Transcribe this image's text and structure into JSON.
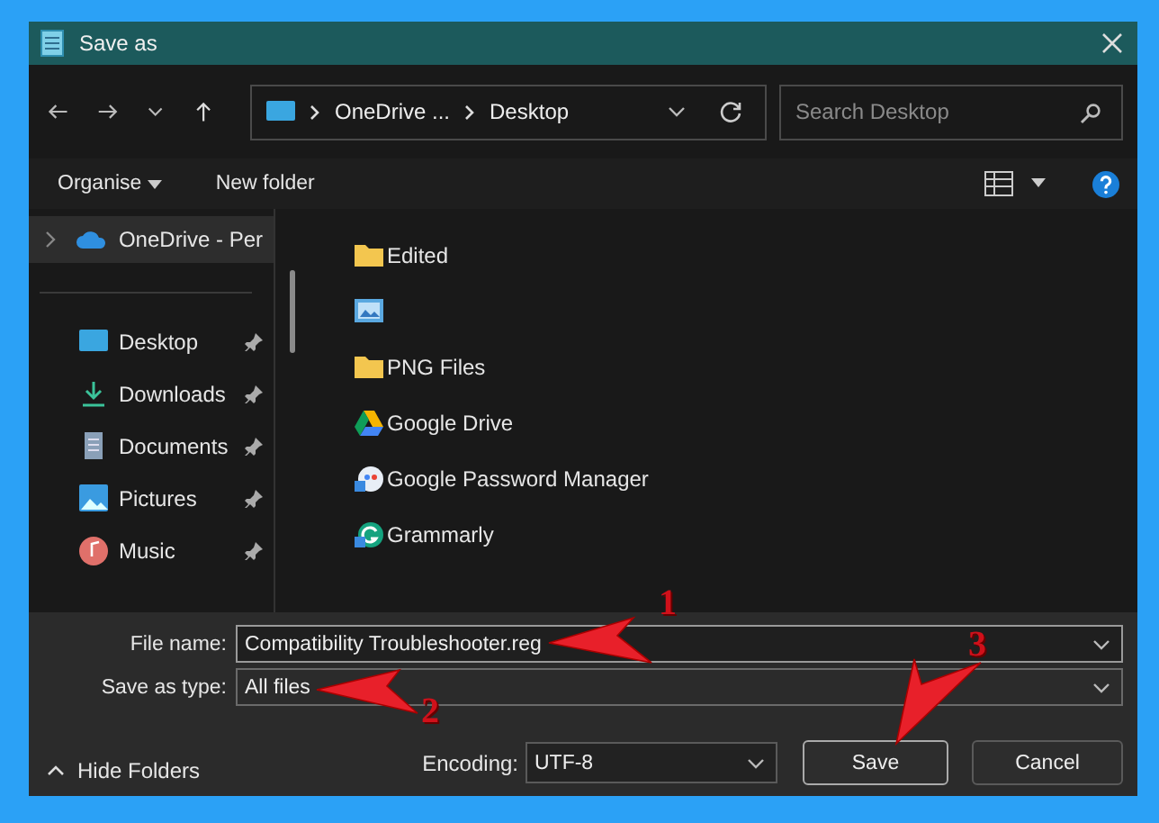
{
  "window": {
    "title": "Save as"
  },
  "address_bar": {
    "segments": [
      "OneDrive ...",
      "Desktop"
    ]
  },
  "search": {
    "placeholder": "Search Desktop"
  },
  "toolbar": {
    "organise": "Organise",
    "new_folder": "New folder"
  },
  "sidebar": {
    "items": [
      {
        "label": "OneDrive - Per",
        "kind": "cloud",
        "selected": true,
        "pinned": false
      },
      {
        "label": "Desktop",
        "kind": "desktop",
        "selected": false,
        "pinned": true
      },
      {
        "label": "Downloads",
        "kind": "download",
        "selected": false,
        "pinned": true
      },
      {
        "label": "Documents",
        "kind": "document",
        "selected": false,
        "pinned": true
      },
      {
        "label": "Pictures",
        "kind": "picture",
        "selected": false,
        "pinned": true
      },
      {
        "label": "Music",
        "kind": "music",
        "selected": false,
        "pinned": true
      }
    ]
  },
  "files": [
    {
      "name": "Edited",
      "kind": "folder"
    },
    {
      "kind": "image"
    },
    {
      "name": "PNG Files",
      "kind": "folder"
    },
    {
      "name": "Google Drive",
      "kind": "drive"
    },
    {
      "name": "Google Password Manager",
      "kind": "password"
    },
    {
      "name": "Grammarly",
      "kind": "grammarly"
    }
  ],
  "form": {
    "file_name_label": "File name:",
    "file_name": "Compatibility Troubleshooter.reg",
    "type_label": "Save as type:",
    "type": "All files",
    "encoding_label": "Encoding:",
    "encoding": "UTF-8"
  },
  "hide_folders": "Hide Folders",
  "buttons": [
    {
      "label": "Save",
      "kind": "primary"
    },
    {
      "label": "Cancel",
      "kind": "secondary"
    }
  ],
  "annotations": [
    {
      "label": "1"
    },
    {
      "label": "2"
    },
    {
      "label": "3"
    }
  ]
}
